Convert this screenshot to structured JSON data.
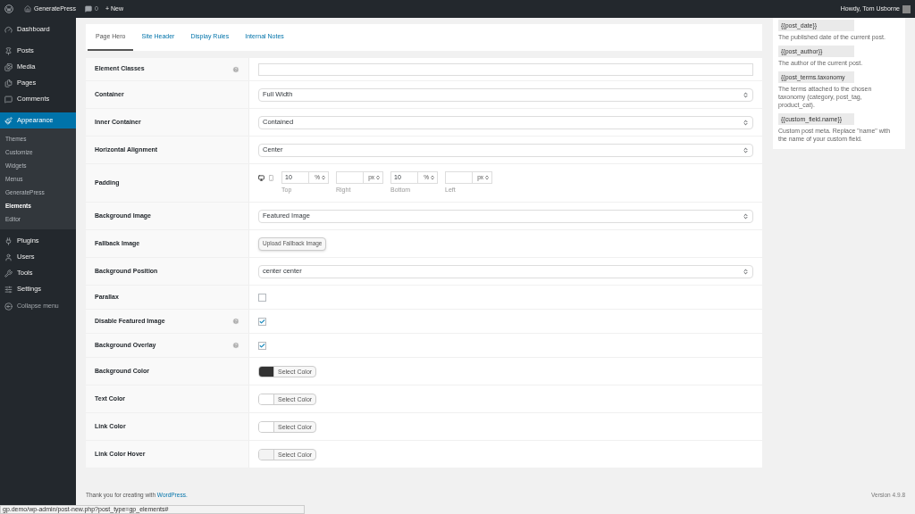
{
  "admin_bar": {
    "site": "GeneratePress",
    "comments": "0",
    "new": "+ New",
    "greeting": "Howdy, Tom Usborne"
  },
  "sidebar": {
    "items": [
      {
        "label": "Dashboard",
        "selected": false
      },
      {
        "label": "Posts",
        "selected": false
      },
      {
        "label": "Media",
        "selected": false
      },
      {
        "label": "Pages",
        "selected": false
      },
      {
        "label": "Comments",
        "selected": false
      },
      {
        "label": "Appearance",
        "selected": true,
        "children": [
          {
            "label": "Themes",
            "selected": false
          },
          {
            "label": "Customize",
            "selected": false
          },
          {
            "label": "Widgets",
            "selected": false
          },
          {
            "label": "Menus",
            "selected": false
          },
          {
            "label": "GeneratePress",
            "selected": false
          },
          {
            "label": "Elements",
            "selected": true
          },
          {
            "label": "Editor",
            "selected": false
          }
        ]
      },
      {
        "label": "Plugins",
        "selected": false
      },
      {
        "label": "Users",
        "selected": false
      },
      {
        "label": "Tools",
        "selected": false
      },
      {
        "label": "Settings",
        "selected": false
      }
    ],
    "collapse": "Collapse menu"
  },
  "tabs": [
    {
      "label": "Page Hero",
      "selected": true
    },
    {
      "label": "Site Header",
      "selected": false
    },
    {
      "label": "Display Rules",
      "selected": false
    },
    {
      "label": "Internal Notes",
      "selected": false
    }
  ],
  "rows": [
    {
      "kind": "text",
      "label": "Element Classes",
      "help": true
    },
    {
      "kind": "select",
      "label": "Container",
      "help": false,
      "value": "Full Width"
    },
    {
      "kind": "select",
      "label": "Inner Container",
      "help": false,
      "value": "Contained"
    },
    {
      "kind": "select",
      "label": "Horizontal Alignment",
      "help": false,
      "value": "Center"
    },
    {
      "kind": "padding",
      "label": "Padding",
      "help": false,
      "sides": [
        {
          "value": "10",
          "unit": "%",
          "label": "Top"
        },
        {
          "unit": "px",
          "label": "Right"
        },
        {
          "value": "10",
          "unit": "%",
          "label": "Bottom"
        },
        {
          "unit": "px",
          "label": "Left"
        }
      ]
    },
    {
      "kind": "select",
      "label": "Background Image",
      "help": false,
      "value": "Featured Image"
    },
    {
      "kind": "button",
      "label": "Fallback Image",
      "help": false,
      "button": "Upload Fallback Image"
    },
    {
      "kind": "select",
      "label": "Background Position",
      "help": false,
      "value": "center center"
    },
    {
      "kind": "checkbox",
      "label": "Parallax",
      "help": false,
      "checked": false
    },
    {
      "kind": "checkbox",
      "label": "Disable Featured Image",
      "help": true,
      "checked": true
    },
    {
      "kind": "checkbox",
      "label": "Background Overlay",
      "help": true,
      "checked": true
    },
    {
      "kind": "color",
      "label": "Background Color",
      "help": false,
      "color": "#333333",
      "button": "Select Color"
    },
    {
      "kind": "color",
      "label": "Text Color",
      "help": false,
      "color": "#ffffff",
      "button": "Select Color"
    },
    {
      "kind": "color",
      "label": "Link Color",
      "help": false,
      "color": "#ffffff",
      "button": "Select Color"
    },
    {
      "kind": "color",
      "label": "Link Color Hover",
      "help": false,
      "color": "#f3f3f3",
      "button": "Select Color"
    }
  ],
  "template_tags": [
    {
      "tag": "{{post_date}}",
      "description": "The published date of the current post."
    },
    {
      "tag": "{{post_author}}",
      "description": "The author of the current post."
    },
    {
      "tag": "{{post_terms.taxonomy",
      "description": "The terms attached to the chosen taxonomy (category, post_tag, product_cat)."
    },
    {
      "tag": "{{custom_field.name}}",
      "description": "Custom post meta. Replace \"name\" with the name of your custom field."
    }
  ],
  "footer": {
    "text": "Thank you for creating with",
    "link": "WordPress.",
    "version": "Version 4.9.8"
  },
  "status_url": "gp.demo/wp-admin/post-new.php?post_type=gp_elements#"
}
